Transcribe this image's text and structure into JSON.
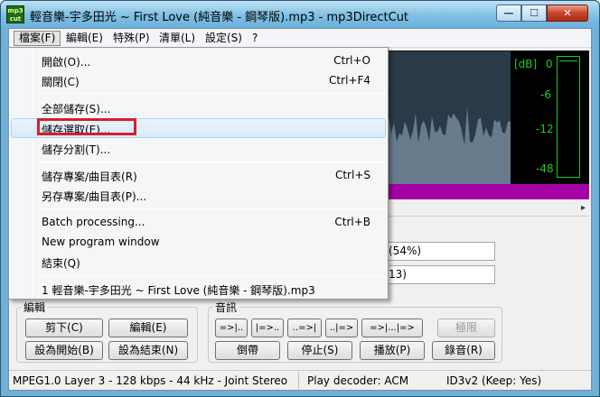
{
  "window": {
    "title": "輕音樂-宇多田光 ~ First Love (純音樂 - 鋼琴版).mp3 - mp3DirectCut",
    "icon_text": "mp3 cut",
    "controls": {
      "minimize": "—",
      "maximize": "☐",
      "close": "✕"
    }
  },
  "menubar": {
    "items": [
      {
        "label": "檔案(F)"
      },
      {
        "label": "編輯(E)"
      },
      {
        "label": "特殊(P)"
      },
      {
        "label": "清單(L)"
      },
      {
        "label": "設定(S)"
      },
      {
        "label": "?"
      }
    ]
  },
  "file_menu": {
    "items": [
      {
        "label": "開啟(O)...",
        "shortcut": "Ctrl+O"
      },
      {
        "label": "關閉(C)",
        "shortcut": "Ctrl+F4"
      },
      {
        "label": "全部儲存(S)...",
        "shortcut": ""
      },
      {
        "label": "儲存選取(E)...",
        "shortcut": ""
      },
      {
        "label": "儲存分割(T)...",
        "shortcut": ""
      },
      {
        "label": "儲存專案/曲目表(R)",
        "shortcut": "Ctrl+S"
      },
      {
        "label": "另存專案/曲目表(P)...",
        "shortcut": ""
      },
      {
        "label": "Batch processing...",
        "shortcut": "Ctrl+B"
      },
      {
        "label": "New program window",
        "shortcut": ""
      },
      {
        "label": "結束(Q)",
        "shortcut": ""
      },
      {
        "label": "1 輕音樂-宇多田光 ~ First Love (純音樂 - 鋼琴版).mp3",
        "shortcut": ""
      }
    ]
  },
  "vu_meter": {
    "labels": [
      "[dB]",
      "0",
      "-6",
      "-12",
      "-48"
    ],
    "color": "#23c823"
  },
  "position": {
    "line1": "(54%)",
    "line2": "13)"
  },
  "edit_group": {
    "title": "編輯",
    "buttons": [
      "剪下(C)",
      "編輯(E)",
      "設為開始(B)",
      "設為結束(N)"
    ]
  },
  "audio_group": {
    "title": "音訊",
    "nav_buttons": [
      "=>|..",
      "|=>..",
      "..=>|",
      "..|=>",
      "=>|...|=>",
      "極限"
    ],
    "transport_buttons": [
      "倒帶",
      "停止(S)",
      "播放(P)",
      "錄音(R)"
    ]
  },
  "statusbar": {
    "format": "MPEG1.0 Layer 3 - 128 kbps - 44 kHz - Joint Stereo",
    "decoder": "Play decoder: ACM",
    "id3": "ID3v2 (Keep: Yes)"
  },
  "colors": {
    "highlight_box": "#d81e2a",
    "waveform_bg": "#2a3a48",
    "waveform_fg": "#9ab1c4",
    "selection_bar": "#a500a5"
  }
}
